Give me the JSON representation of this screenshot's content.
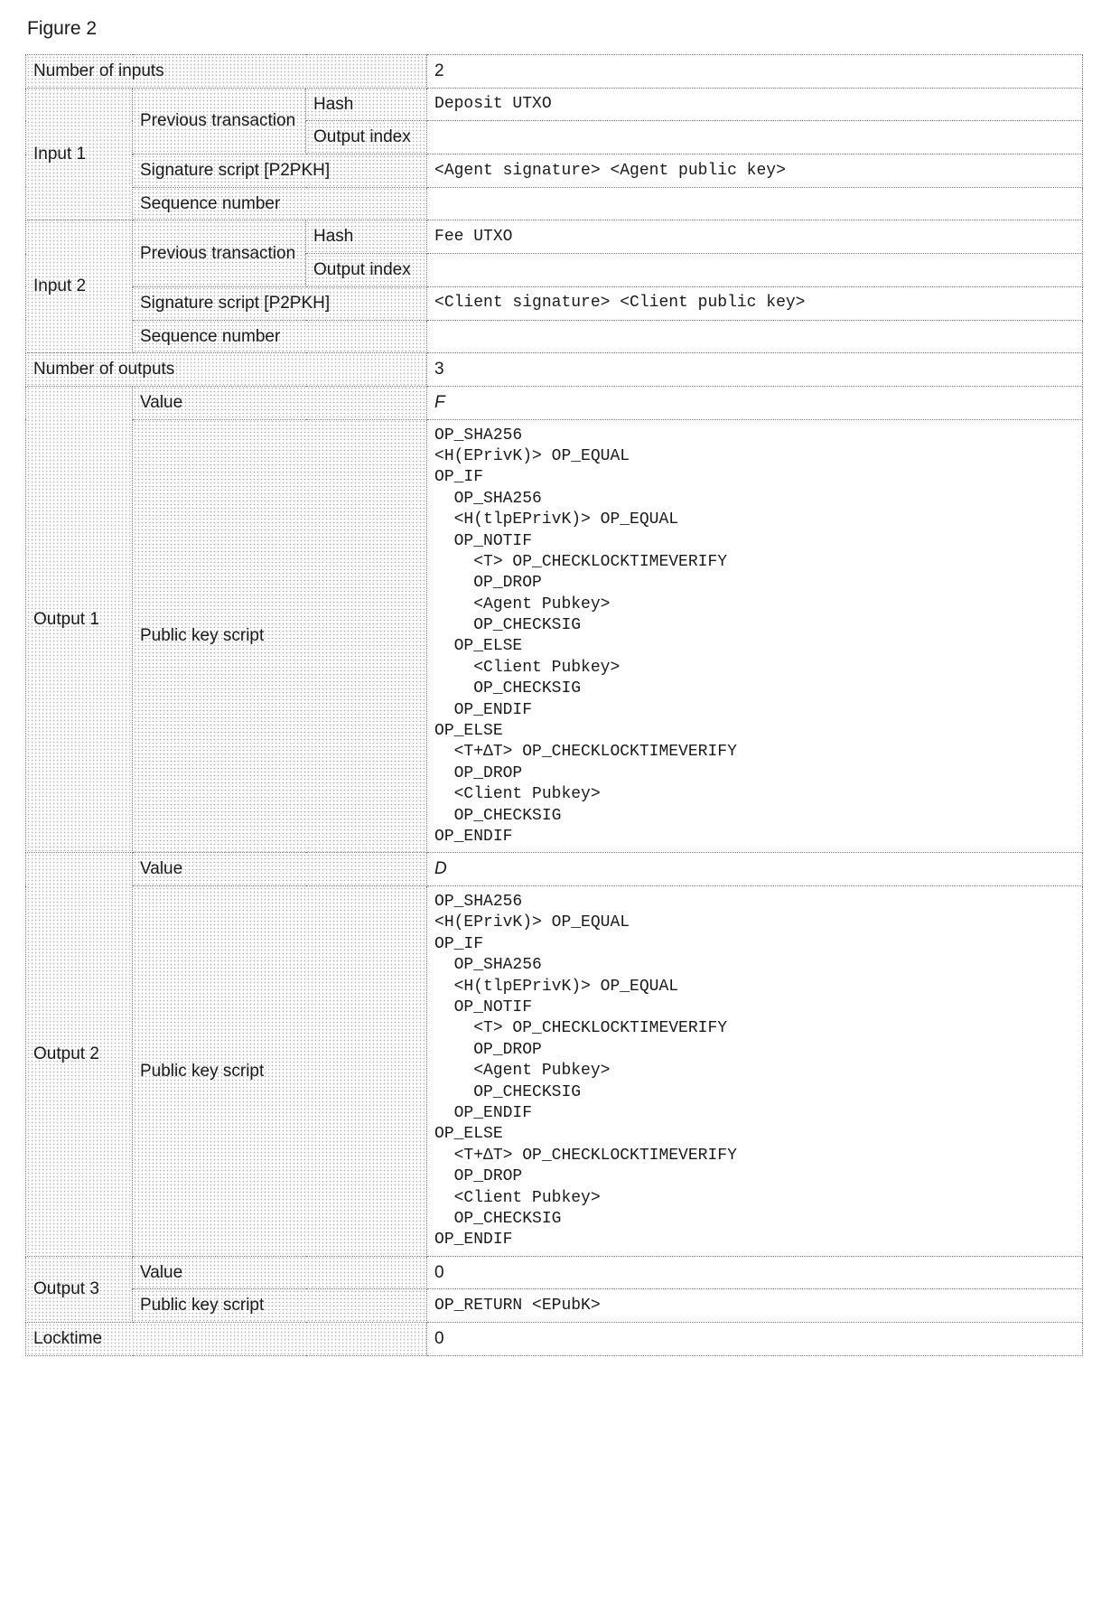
{
  "figure_label": "Figure 2",
  "tx": {
    "num_inputs": {
      "label": "Number of inputs",
      "value": "2"
    },
    "inputs": [
      {
        "name": "Input 1",
        "prev_tx_label": "Previous transaction",
        "hash_label": "Hash",
        "hash_value": "Deposit UTXO",
        "out_idx_label": "Output index",
        "out_idx_value": "",
        "sig_label": "Signature script [P2PKH]",
        "sig_value": "<Agent signature> <Agent public key>",
        "seq_label": "Sequence number",
        "seq_value": ""
      },
      {
        "name": "Input 2",
        "prev_tx_label": "Previous transaction",
        "hash_label": "Hash",
        "hash_value": "Fee UTXO",
        "out_idx_label": "Output index",
        "out_idx_value": "",
        "sig_label": "Signature script [P2PKH]",
        "sig_value": "<Client signature> <Client public key>",
        "seq_label": "Sequence number",
        "seq_value": ""
      }
    ],
    "num_outputs": {
      "label": "Number of outputs",
      "value": "3"
    },
    "outputs": [
      {
        "name": "Output 1",
        "value_label": "Value",
        "value": "F",
        "pks_label": "Public key script",
        "pks": "OP_SHA256\n<H(EPrivK)> OP_EQUAL\nOP_IF\n  OP_SHA256\n  <H(tlpEPrivK)> OP_EQUAL\n  OP_NOTIF\n    <T> OP_CHECKLOCKTIMEVERIFY\n    OP_DROP\n    <Agent Pubkey>\n    OP_CHECKSIG\n  OP_ELSE\n    <Client Pubkey>\n    OP_CHECKSIG\n  OP_ENDIF\nOP_ELSE\n  <T+ΔT> OP_CHECKLOCKTIMEVERIFY\n  OP_DROP\n  <Client Pubkey>\n  OP_CHECKSIG\nOP_ENDIF"
      },
      {
        "name": "Output 2",
        "value_label": "Value",
        "value": "D",
        "pks_label": "Public key script",
        "pks": "OP_SHA256\n<H(EPrivK)> OP_EQUAL\nOP_IF\n  OP_SHA256\n  <H(tlpEPrivK)> OP_EQUAL\n  OP_NOTIF\n    <T> OP_CHECKLOCKTIMEVERIFY\n    OP_DROP\n    <Agent Pubkey>\n    OP_CHECKSIG\n  OP_ENDIF\nOP_ELSE\n  <T+ΔT> OP_CHECKLOCKTIMEVERIFY\n  OP_DROP\n  <Client Pubkey>\n  OP_CHECKSIG\nOP_ENDIF"
      },
      {
        "name": "Output 3",
        "value_label": "Value",
        "value": "0",
        "pks_label": "Public key script",
        "pks": "OP_RETURN <EPubK>"
      }
    ],
    "locktime": {
      "label": "Locktime",
      "value": "0"
    }
  }
}
